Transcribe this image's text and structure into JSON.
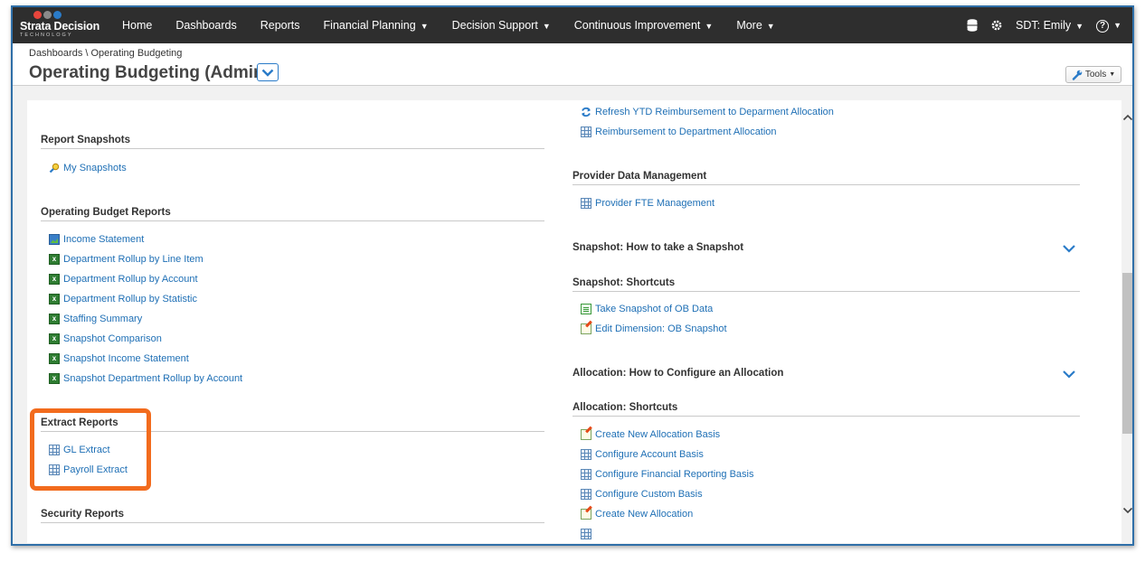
{
  "brand": {
    "name": "Strata Decision",
    "tagline": "TECHNOLOGY"
  },
  "nav": {
    "items": [
      {
        "label": "Home"
      },
      {
        "label": "Dashboards"
      },
      {
        "label": "Reports"
      },
      {
        "label": "Financial Planning",
        "dropdown": true
      },
      {
        "label": "Decision Support",
        "dropdown": true
      },
      {
        "label": "Continuous Improvement",
        "dropdown": true
      },
      {
        "label": "More",
        "dropdown": true
      }
    ],
    "user": "SDT: Emily",
    "icons": [
      "database-icon",
      "gear-icon",
      "help-icon"
    ]
  },
  "header": {
    "breadcrumb": "Dashboards \\ Operating Budgeting",
    "title": "Operating Budgeting (Admin)",
    "tools_label": "Tools"
  },
  "left": {
    "report_snapshots": {
      "title": "Report Snapshots",
      "links": [
        "My Snapshots"
      ]
    },
    "operating_budget_reports": {
      "title": "Operating Budget Reports",
      "links": [
        "Income Statement",
        "Department Rollup by Line Item",
        "Department Rollup by Account",
        "Department Rollup by Statistic",
        "Staffing Summary",
        "Snapshot Comparison",
        "Snapshot Income Statement",
        "Snapshot Department Rollup by Account"
      ]
    },
    "extract_reports": {
      "title": "Extract Reports",
      "links": [
        "GL Extract",
        "Payroll Extract"
      ]
    },
    "security_reports": {
      "title": "Security Reports"
    }
  },
  "right": {
    "top_links": [
      "Refresh YTD Reimbursement to Deparment Allocation",
      "Reimbursement to Department Allocation"
    ],
    "provider": {
      "title": "Provider Data Management",
      "links": [
        "Provider FTE Management"
      ]
    },
    "snapshot_howto": {
      "title": "Snapshot: How to take a Snapshot"
    },
    "snapshot_shortcuts": {
      "title": "Snapshot: Shortcuts",
      "links": [
        "Take Snapshot of OB Data",
        "Edit Dimension: OB Snapshot"
      ]
    },
    "allocation_howto": {
      "title": "Allocation: How to Configure an Allocation"
    },
    "allocation_shortcuts": {
      "title": "Allocation: Shortcuts",
      "links": [
        "Create New Allocation Basis",
        "Configure Account Basis",
        "Configure Financial Reporting Basis",
        "Configure Custom Basis",
        "Create New Allocation"
      ]
    }
  },
  "colors": {
    "accent": "#1e6fb5",
    "highlight": "#f26b1d",
    "nav_bg": "#2e2e2e"
  }
}
